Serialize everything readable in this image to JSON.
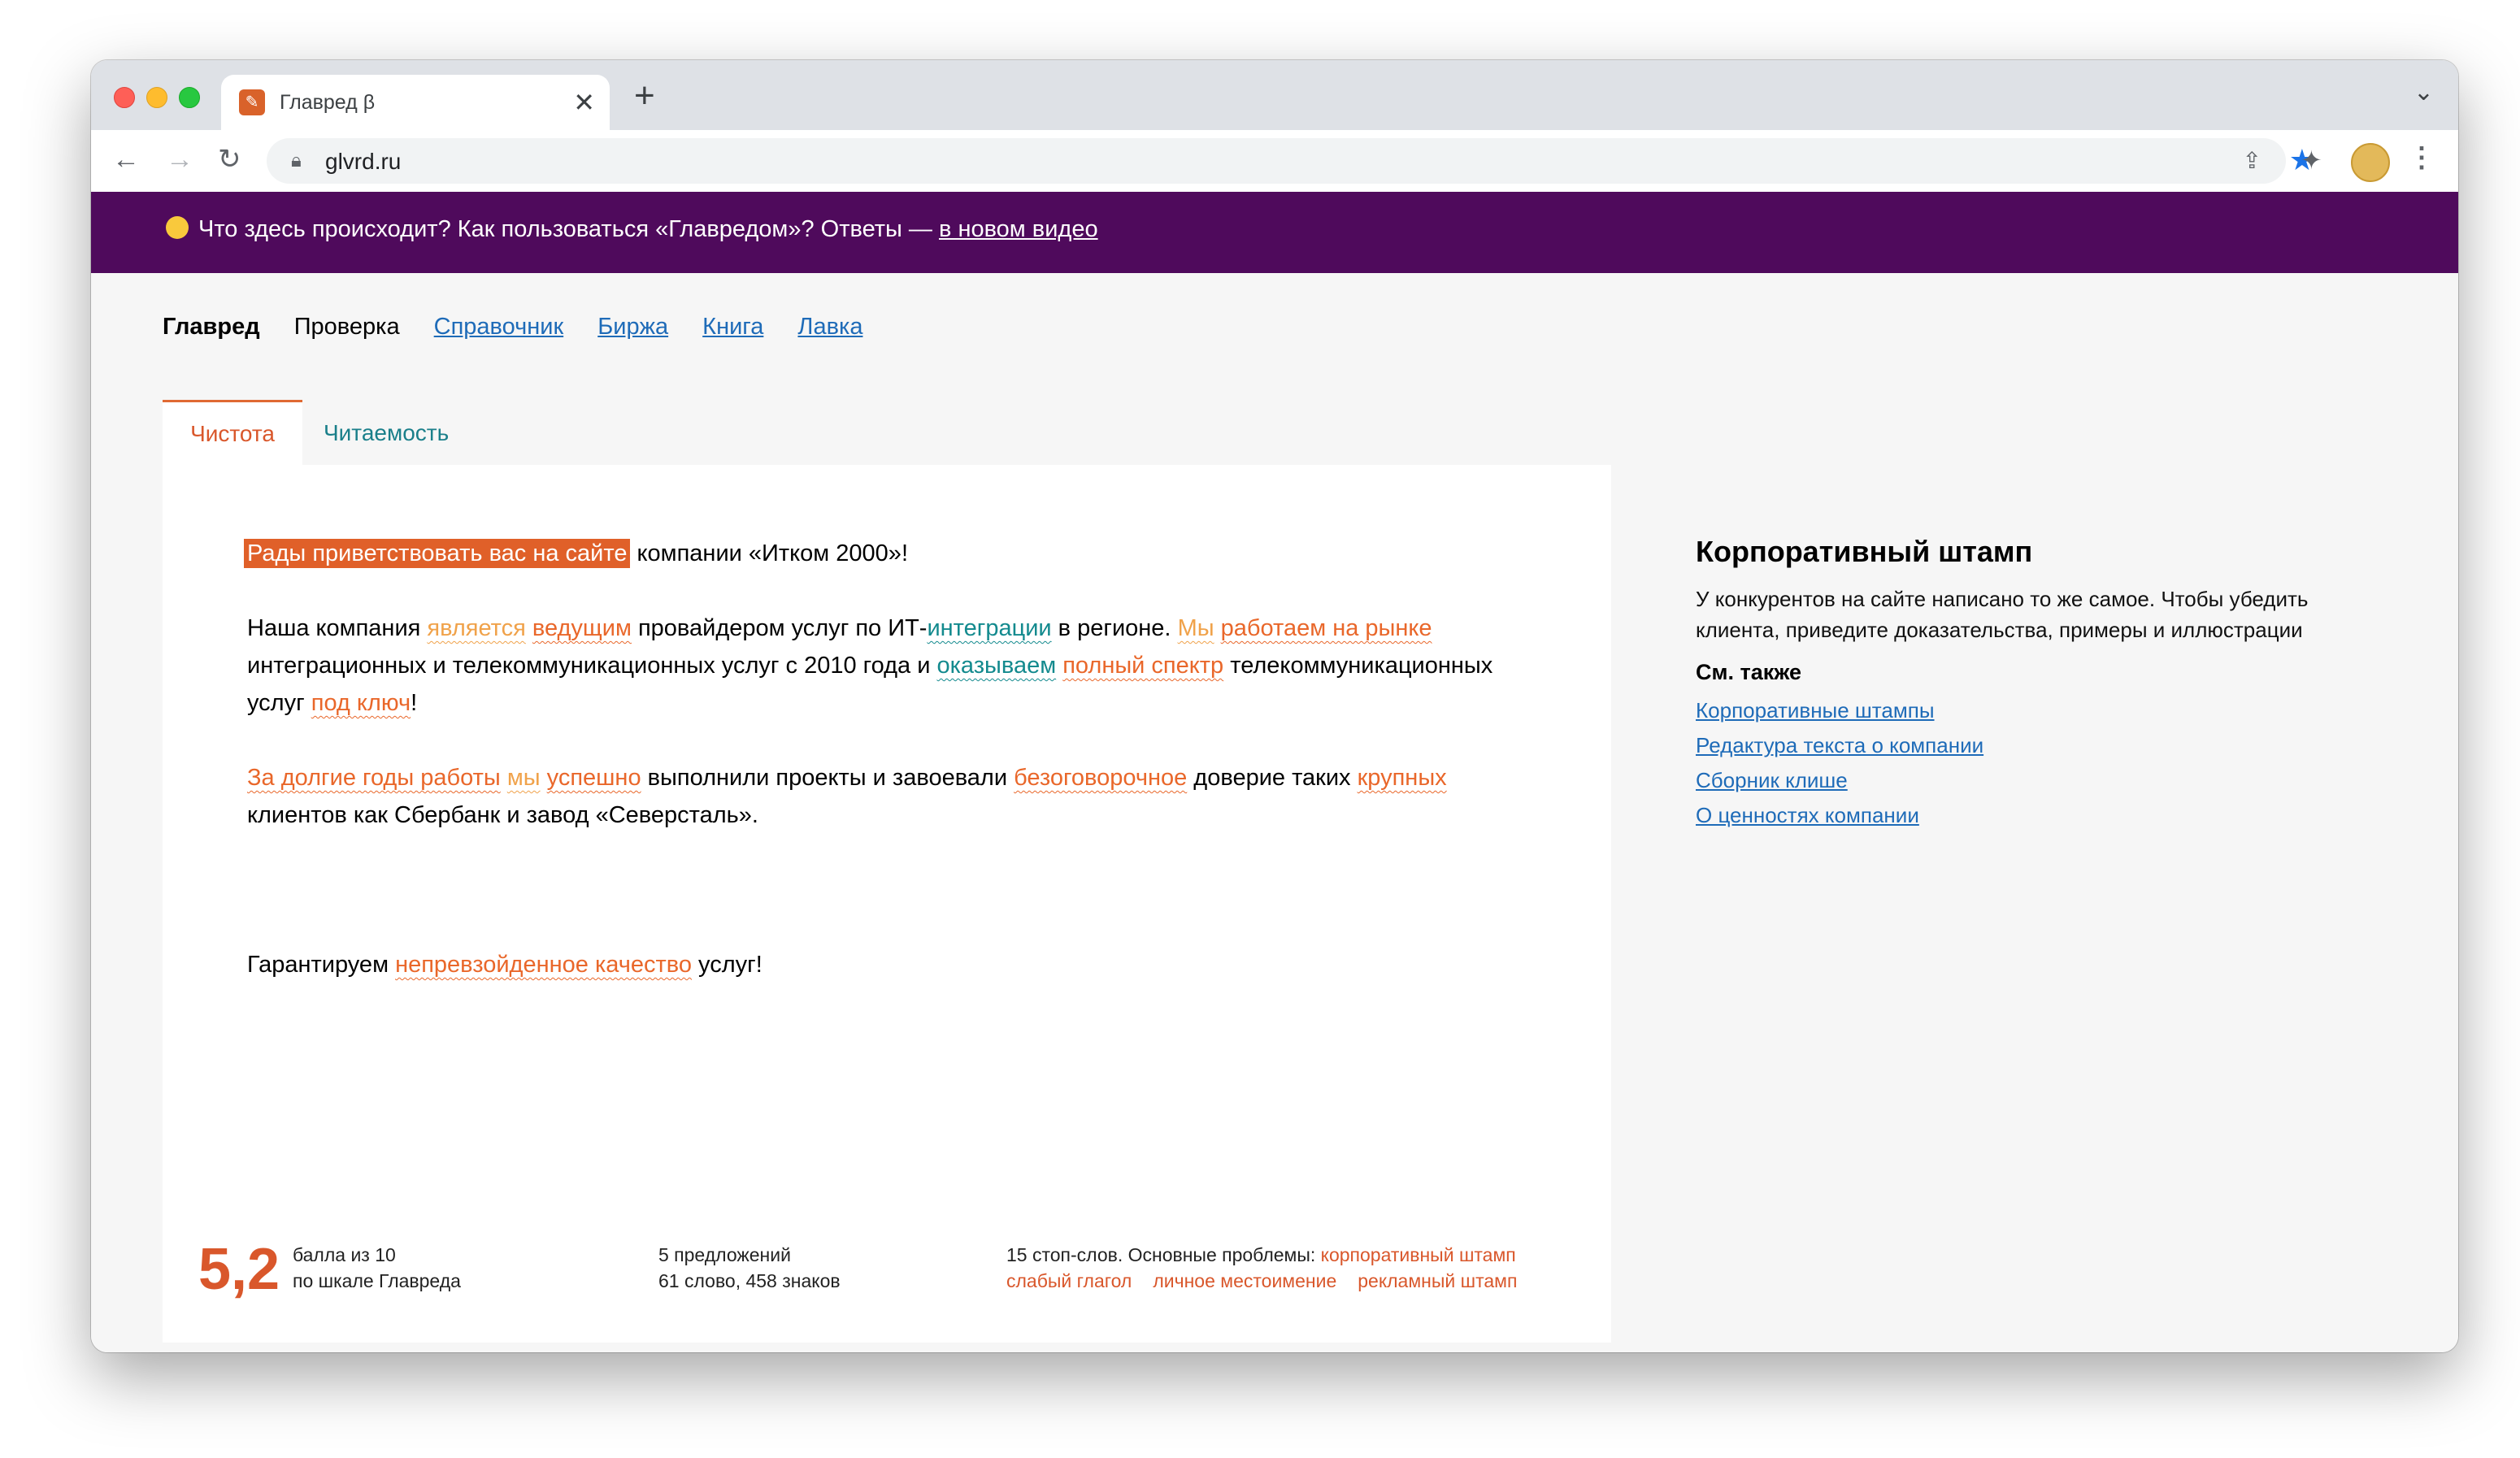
{
  "browser": {
    "tab_title": "Главред β",
    "url": "glvrd.ru"
  },
  "banner": {
    "text": "Что здесь происходит? Как пользоваться «Главредом»? Ответы — ",
    "link": "в новом видео"
  },
  "topnav": {
    "items": [
      "Главред",
      "Проверка",
      "Справочник",
      "Биржа",
      "Книга",
      "Лавка"
    ]
  },
  "tabs": [
    "Чистота",
    "Читаемость"
  ],
  "editor": {
    "p1": {
      "sel": "Рады приветствовать вас на сайте",
      "rest": " компании «Итком 2000»!"
    },
    "p2": {
      "s1": "Наша компания ",
      "w1": "является",
      "s2": " ",
      "w2": "ведущим",
      "s3": " провайдером услуг по ИТ-",
      "w3": "интеграции",
      "s4": " в регионе. ",
      "w4": "Мы",
      "s5": " ",
      "w5": "работаем на рынке",
      "s6": " интеграционных и телекоммуникационных услуг с 2010 года и ",
      "w6": "оказываем",
      "s7": " ",
      "w7": "полный спектр",
      "s8": " телекоммуникационных услуг ",
      "w8": "под ключ",
      "s9": "!"
    },
    "p3": {
      "w1": "За долгие годы работы",
      "s1": " ",
      "w2": "мы",
      "s2": " ",
      "w3": "успешно",
      "s3": " выполнили проекты и завоевали ",
      "w4": "безоговорочное",
      "s4": " доверие таких ",
      "w5": "крупных",
      "s5": " клиентов как Сбербанк и завод «Северсталь»."
    },
    "p4": {
      "s1": "Гарантируем ",
      "w1": "непревзойденное качество",
      "s2": " услуг!"
    }
  },
  "footer": {
    "score": "5,2",
    "score_line1": "балла из 10",
    "score_line2": "по шкале Главреда",
    "stats_line1": "5 предложений",
    "stats_line2": "61 слово, 458 знаков",
    "problems_label": "15 стоп-слов. Основные проблемы: ",
    "problems": [
      "корпоративный штамп",
      "слабый глагол",
      "личное местоимение",
      "рекламный штамп"
    ]
  },
  "sidebar": {
    "title": "Корпоративный штамп",
    "text": "У конкурентов на сайте написано то же самое. Чтобы убедить клиента, приведите доказательства, примеры и иллюстрации",
    "see_also": "См. также",
    "links": [
      "Корпоративные штампы",
      "Редактура текста о компании",
      "Сборник клише",
      "О ценностях компании"
    ]
  },
  "colors": {
    "banner": "#4f0a5c",
    "accent": "#d9572b",
    "teal": "#138a8e",
    "link": "#1e6bb8"
  }
}
